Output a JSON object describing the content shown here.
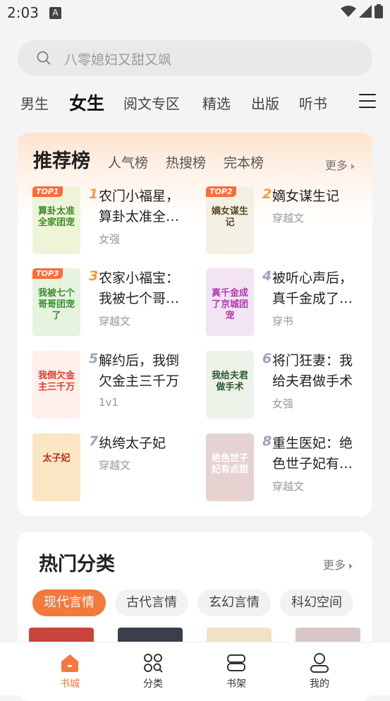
{
  "status": {
    "time": "2:03",
    "notif": "A"
  },
  "search": {
    "placeholder": "八零媳妇又甜又飒"
  },
  "tabs": [
    "男生",
    "女生",
    "阅文专区",
    "精选",
    "出版",
    "听书"
  ],
  "ranking": {
    "title": "推荐榜",
    "subtabs": [
      "人气榜",
      "热搜榜",
      "完本榜"
    ],
    "more": "更多",
    "books": [
      {
        "rank": "1",
        "badge": "TOP1",
        "title": "农门小福星，算卦太准全…",
        "tag": "女强",
        "cover_text": "算卦太准全家团宠",
        "cover_bg": "#eef4d8",
        "cover_fg": "#3f8a2a"
      },
      {
        "rank": "2",
        "badge": "TOP2",
        "title": "嫡女谋生记",
        "tag": "穿越文",
        "cover_text": "嫡女谋生记",
        "cover_bg": "#f3f0e4",
        "cover_fg": "#5a4a2a"
      },
      {
        "rank": "3",
        "badge": "TOP3",
        "title": "农家小福宝：我被七个哥…",
        "tag": "穿越文",
        "cover_text": "我被七个哥哥团宠了",
        "cover_bg": "#e6f3df",
        "cover_fg": "#3b8f35"
      },
      {
        "rank": "4",
        "badge": "",
        "title": "被听心声后，真千金成了…",
        "tag": "穿书",
        "cover_text": "真千金成了京城团宠",
        "cover_bg": "#f3e4f4",
        "cover_fg": "#b03aa8"
      },
      {
        "rank": "5",
        "badge": "",
        "title": "解约后，我倒欠金主三千万",
        "tag": "1v1",
        "cover_text": "我倒欠金主三千万",
        "cover_bg": "#fff0ec",
        "cover_fg": "#e23b2a"
      },
      {
        "rank": "6",
        "badge": "",
        "title": "将门狂妻：我给夫君做手术",
        "tag": "女强",
        "cover_text": "我给夫君做手术",
        "cover_bg": "#eef3ea",
        "cover_fg": "#2f5a2f"
      },
      {
        "rank": "7",
        "badge": "",
        "title": "纨绔太子妃",
        "tag": "穿越文",
        "cover_text": "太子妃",
        "cover_bg": "#fbe6c4",
        "cover_fg": "#b5301c"
      },
      {
        "rank": "8",
        "badge": "",
        "title": "重生医妃：绝色世子妃有…",
        "tag": "穿越文",
        "cover_text": "绝色世子妃有点甜",
        "cover_bg": "#e7d2d2",
        "cover_fg": "#ffffff"
      }
    ]
  },
  "categories": {
    "title": "热门分类",
    "more": "更多",
    "chips": [
      "现代言情",
      "古代言情",
      "玄幻言情",
      "科幻空间"
    ],
    "thumb_colors": [
      "#c9443a",
      "#3a3f4d",
      "#efe2c6",
      "#d9c7c7"
    ]
  },
  "bottom_nav": [
    "书城",
    "分类",
    "书架",
    "我的"
  ],
  "colors": {
    "accent": "#f4793c",
    "rank_num": "#f59a3b",
    "rank_num_low": "#9aa6b6"
  }
}
